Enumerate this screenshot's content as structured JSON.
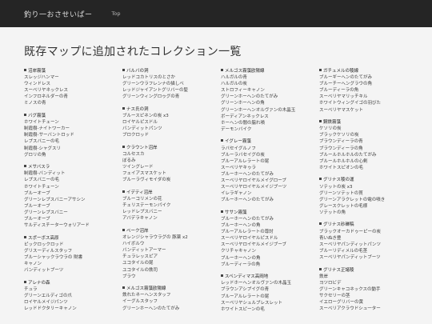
{
  "header": {
    "brand": "釣り一おさせいぱー",
    "nav_top": "Top"
  },
  "page_title": "既存マップに追加されたコレクション一覧",
  "columns": [
    [
      {
        "title": "沼岸霧藻",
        "items": [
          "スレッジハンマー",
          "ウィンドレス",
          "スーベリヤネックレス",
          "インフロネルダーの青",
          "ミノスの青"
        ]
      },
      {
        "title": "バグ霧藻",
        "items": [
          "ホワイトチェーン",
          "制霞樹-ナイトワーカー",
          "制霞樹-サーバントロッド",
          "レプスバニーの毛",
          "制霞樹-シャグスリ",
          "グロリの角"
        ]
      },
      {
        "title": "メサバスラ",
        "items": [
          "制霞樹-バンディット",
          "レプスバニーの毛",
          "ホワイトチェーン",
          "ブルーオーブ",
          "グリーンレプスバニーアサシン",
          "ブルーオーブ",
          "グリーンレプスバニー",
          "ブルーオーブ",
          "サルディスチーターウォリアード"
        ]
      },
      {
        "title": "スポーボス高原",
        "items": [
          "ピックロックロッド",
          "グリスーディルスタッフ",
          "ブルーシャックラウラの 財書",
          "キャノン",
          "バンディットブーツ"
        ]
      },
      {
        "title": "アレナの森",
        "items": [
          "チュラ",
          "グリーンエルディゴの爪",
          "ロイヤルメイジパンツ",
          "レッドドクタリーキャノン"
        ]
      }
    ],
    [
      {
        "title": "バルバの洞",
        "items": [
          "レッドコカトリスのとさか",
          "グリーンウラフレンナの描しベ",
          "レッドジャイアントグリバーの髪",
          "グリーンウィングロゥグの青"
        ]
      },
      {
        "title": "ナス氏の洞",
        "items": [
          "ブルースピネンの炭 x3",
          "ロイヤルピスドル",
          "バンディットパンツ",
          "ブロクロッド"
        ]
      },
      {
        "title": "クラウント沼岸",
        "items": [
          "コルセスカ",
          "ぼるみ",
          "ツイングレード",
          "フェイアスマスケット",
          "ブルーラヴィモイダの炭"
        ]
      },
      {
        "title": "イデティ沼岸",
        "items": [
          "ブルーコリメンの花",
          "チェリステーモンパイク",
          "レッドレプスバニー",
          "アバデラキャノン"
        ]
      },
      {
        "title": "ベーク沼岸",
        "items": [
          "オレンジシャラウラグの 豚薬 x2",
          "ハイボルウ",
          "バンディットアーマー",
          "チュラレッスピア",
          "ユコタイルの尾",
          "ユコタイルの鉄司",
          "ブラウ"
        ]
      },
      {
        "title": "メルゴス霧藻欧陽線",
        "items": [
          "鉄れたネーヘンスタッフ",
          "イーグルスタッフ",
          "グリーンホーへンのたてがみ"
        ]
      }
    ],
    [
      {
        "title": "メルゴス霧藻欧陽線",
        "items": [
          "ハルガルの青",
          "ハルガルの炭",
          "ストロフィーキャノン",
          "グリーンホーへンのたてがみ",
          "グリーンホーヘンの角",
          "グリーンホーヘンオルヴァンの木晶玉",
          "ボーディアンネックレス",
          "ホーヘンの闇の脇れ噴",
          "デーモンバイク"
        ]
      },
      {
        "title": "イグレー霧藻",
        "items": [
          "ラバセイグルノフ",
          "ブルーラバセイグの炭",
          "ブルーアルレラートの尾",
          "スーベリヤキゥラ",
          "ブルーホーへンのたてがみ",
          "スーベリヤロイヤルメイグロープ",
          "スーベリヤロイヤルメイジブーツ",
          "イレラギャノン",
          "ブルーホーへンのたてがみ"
        ]
      },
      {
        "title": "ササン霧藻",
        "items": [
          "ブルーホーへンのたてがみ",
          "ブルーホーへンの角",
          "ブルーアルレラートの尊討",
          "スーベリヤロイヤルピスドル",
          "スーベリヤロイヤルメイジブーブ",
          "クリチャキャノン",
          "ブルーホーヘンの角",
          "ブルーディーラの角"
        ]
      },
      {
        "title": "スペンディマス高岡地",
        "items": [
          "レッドホーへンオルヴァンの木晶玉",
          "ブラウンアシプイグの青",
          "ブルーアルレラートの尾",
          "スーベリヤシュルブレスレット",
          "ホワイトスピーンの毛"
        ]
      }
    ],
    [
      {
        "title": "ガチュメルの稜線",
        "items": [
          "ブルーギーへンのたてがみ",
          "ブルーチーへングラウの角",
          "ブルーディーラの角",
          "スーベリヤマリッチキル",
          "ホワイトウィングイゴの羽びた",
          "スーベリヤマスケット"
        ]
      },
      {
        "title": "鋼鉄霧藻",
        "items": [
          "ケソリの炭",
          "ブラックケソリの炭",
          "ブラウンディーラの青",
          "ブラウンディーラの角",
          "ブルールホルホルのたてがみ",
          "ブルールホルホルの心剣",
          "ホワイトスピオンの毛"
        ]
      },
      {
        "title": "グリナス稜の運",
        "items": [
          "ソテットの炭 x3",
          "グリーンソテットの貫",
          "グリーンアラクレットの電の噴き",
          "グレースクレットの毛様",
          "ソテットの角"
        ]
      },
      {
        "title": "グリナス砂礫稿",
        "items": [
          "ブラックオーカドゥーピーの炭",
          "青いぬき豊",
          "スーベリヤパンディットパンツ",
          "ブルーリディメルの毛茎",
          "スーベリヤパンディットブーツ"
        ]
      },
      {
        "title": "グリナス正諸稜",
        "items": [
          "鉄岸",
          "ヨツロビデ",
          "グリーンキャコネックスの動手",
          "サクセリーの茎",
          "イエローグリバーの黄",
          "スーベリアクラウドシュ一ター"
        ]
      }
    ]
  ]
}
